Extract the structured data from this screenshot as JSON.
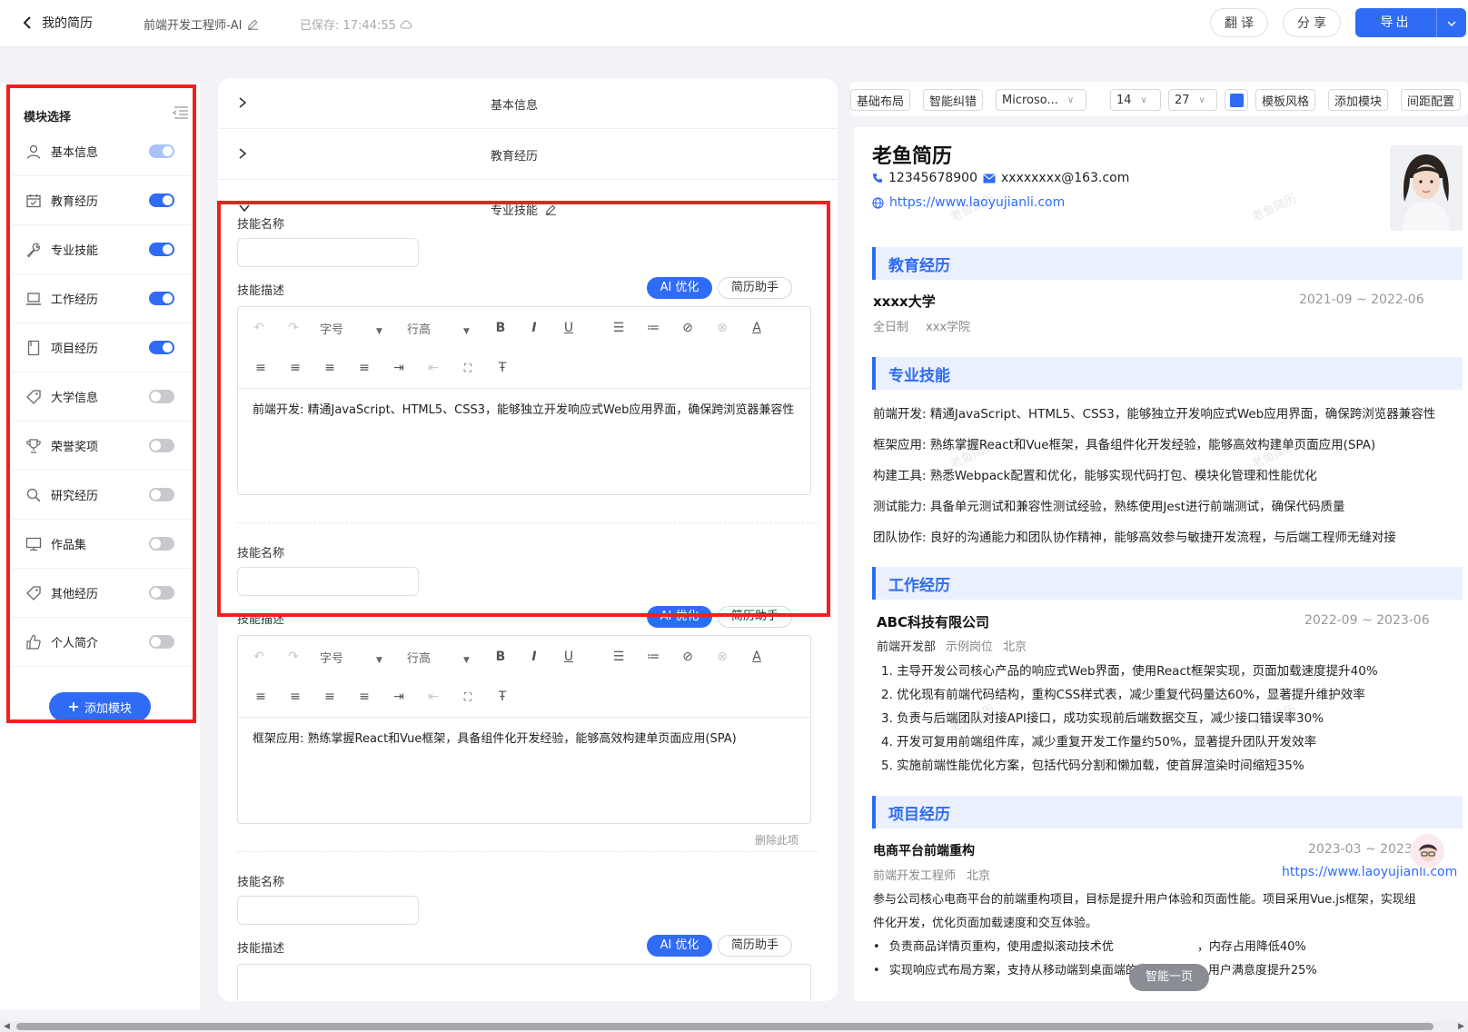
{
  "topbar": {
    "back_label": "我的简历",
    "resume_title": "前端开发工程师-AI",
    "saved_status": "已保存: 17:44:55",
    "translate_label": "翻译",
    "share_label": "分享",
    "export_label": "导出"
  },
  "modules": {
    "title": "模块选择",
    "add_label": "添加模块",
    "items": [
      {
        "label": "基本信息",
        "icon": "user-icon",
        "state": "dim"
      },
      {
        "label": "教育经历",
        "icon": "calendar-icon",
        "state": "on"
      },
      {
        "label": "专业技能",
        "icon": "wrench-icon",
        "state": "on"
      },
      {
        "label": "工作经历",
        "icon": "laptop-icon",
        "state": "on"
      },
      {
        "label": "项目经历",
        "icon": "document-icon",
        "state": "on"
      },
      {
        "label": "大学信息",
        "icon": "tag-icon",
        "state": "off"
      },
      {
        "label": "荣誉奖项",
        "icon": "trophy-icon",
        "state": "off"
      },
      {
        "label": "研究经历",
        "icon": "search-icon",
        "state": "off"
      },
      {
        "label": "作品集",
        "icon": "monitor-icon",
        "state": "off"
      },
      {
        "label": "其他经历",
        "icon": "tag-icon",
        "state": "off"
      },
      {
        "label": "个人简介",
        "icon": "thumbs-up-icon",
        "state": "off"
      }
    ]
  },
  "editor": {
    "sections": [
      "基本信息",
      "教育经历",
      "专业技能"
    ],
    "skill_name_label": "技能名称",
    "skill_desc_label": "技能描述",
    "ai_label": "AI 优化",
    "helper_label": "简历助手",
    "font_size_label": "字号",
    "line_height_label": "行高",
    "delete_label": "删除此项",
    "skill_1_text": "前端开发: 精通JavaScript、HTML5、CSS3，能够独立开发响应式Web应用界面，确保跨浏览器兼容性",
    "skill_2_text": "框架应用: 熟练掌握React和Vue框架，具备组件化开发经验，能够高效构建单页面应用(SPA)"
  },
  "toolbar": {
    "layout": "基础布局",
    "spellcheck": "智能纠错",
    "font": "Microso...",
    "font_size": "14",
    "line_size": "27",
    "accent_color": "#2f6bf5",
    "template": "模板风格",
    "add_module": "添加模块",
    "spacing": "间距配置"
  },
  "resume": {
    "name": "老鱼简历",
    "phone": "12345678900",
    "email": "xxxxxxxx@163.com",
    "website": "https://www.laoyujianli.com",
    "watermark": "老鱼简历",
    "education": {
      "title": "教育经历",
      "school": "xxxx大学",
      "date": "2021-09 ~ 2022-06",
      "type": "全日制",
      "college": "xxx学院"
    },
    "skills": {
      "title": "专业技能",
      "items": [
        "前端开发: 精通JavaScript、HTML5、CSS3，能够独立开发响应式Web应用界面，确保跨浏览器兼容性",
        "框架应用: 熟练掌握React和Vue框架，具备组件化开发经验，能够高效构建单页面应用(SPA)",
        "构建工具: 熟悉Webpack配置和优化，能够实现代码打包、模块化管理和性能优化",
        "测试能力: 具备单元测试和兼容性测试经验，熟练使用Jest进行前端测试，确保代码质量",
        "团队协作: 良好的沟通能力和团队协作精神，能够高效参与敏捷开发流程，与后端工程师无缝对接"
      ]
    },
    "work": {
      "title": "工作经历",
      "company": "ABC科技有限公司",
      "date": "2022-09 ~ 2023-06",
      "dept": "前端开发部",
      "position": "示例岗位",
      "city": "北京",
      "items": [
        "1. 主导开发公司核心产品的响应式Web界面，使用React框架实现，页面加载速度提升40%",
        "2. 优化现有前端代码结构，重构CSS样式表，减少重复代码量达60%，显著提升维护效率",
        "3. 负责与后端团队对接API接口，成功实现前后端数据交互，减少接口错误率30%",
        "4. 开发可复用前端组件库，减少重复开发工作量约50%，显著提升团队开发效率",
        "5. 实施前端性能优化方案，包括代码分割和懒加载，使首屏渲染时间缩短35%"
      ]
    },
    "project": {
      "title": "项目经历",
      "name": "电商平台前端重构",
      "date": "2023-03 ~ 2023-06",
      "role": "前端开发工程师",
      "city": "北京",
      "link": "https://www.laoyujianli.com",
      "desc_1": "参与公司核心电商平台的前端重构项目，目标是提升用户体验和页面性能。项目采用Vue.js框架，实现组",
      "desc_2": "件化开发，优化页面加载速度和交互体验。",
      "bullet_1": "负责商品详情页重构，使用虚拟滚动技术优",
      "bullet_1b": "，内存占用降低40%",
      "bullet_2": "实现响应式布局方案，支持从移动端到桌面端的全设备适配，用户满意度提升25%"
    },
    "smart_page_label": "智能一页"
  }
}
